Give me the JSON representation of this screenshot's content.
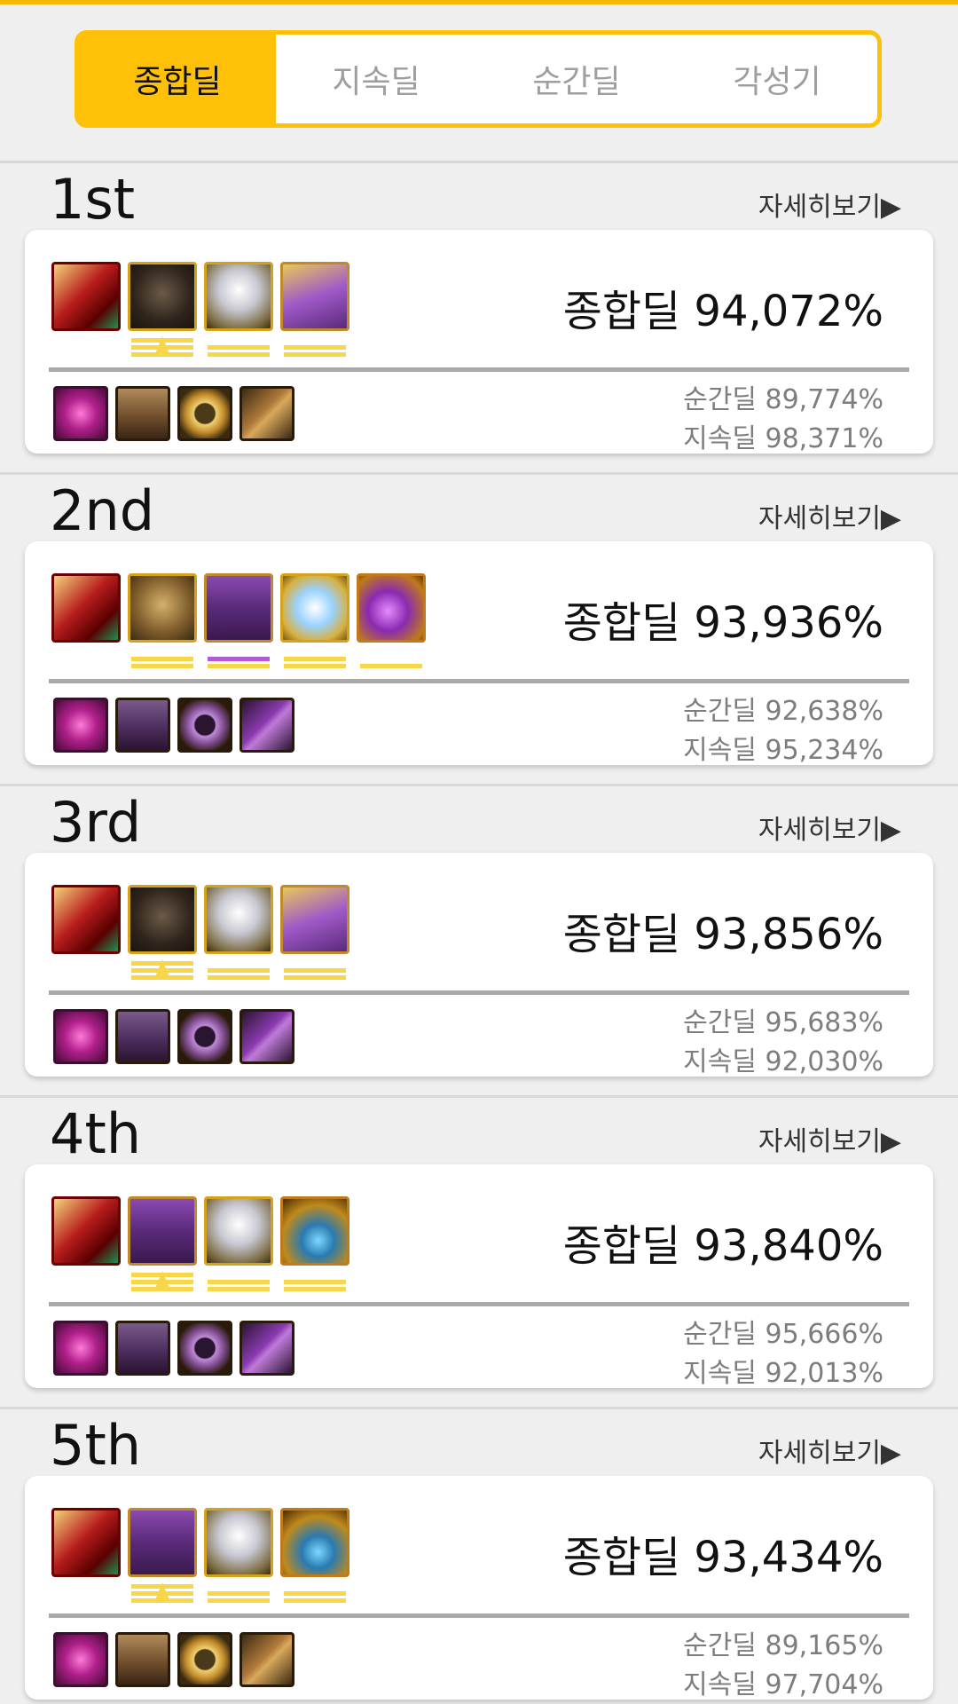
{
  "tabs": [
    {
      "label": "종합딜",
      "active": true
    },
    {
      "label": "지속딜",
      "active": false
    },
    {
      "label": "순간딜",
      "active": false
    },
    {
      "label": "각성기",
      "active": false
    }
  ],
  "detail_label": "자세히보기▶",
  "entries": [
    {
      "rank": "1st",
      "total": "종합딜 94,072%",
      "burst": "순간딜 89,774%",
      "sustain": "지속딜 98,371%",
      "top_icons": [
        "weapon-icon",
        "armor-icon",
        "helmet-icon",
        "crystal-icon"
      ],
      "bottom_icons": [
        "rose-icon",
        "pants-icon",
        "ring-icon",
        "spike-icon"
      ]
    },
    {
      "rank": "2nd",
      "total": "종합딜 93,936%",
      "burst": "순간딜 92,638%",
      "sustain": "지속딜 95,234%",
      "top_icons": [
        "weapon-icon",
        "armor-icon",
        "robe-icon",
        "orb-icon",
        "gem-icon"
      ],
      "bottom_icons": [
        "rose-icon",
        "pants-icon",
        "ring-icon",
        "spike-icon"
      ]
    },
    {
      "rank": "3rd",
      "total": "종합딜 93,856%",
      "burst": "순간딜 95,683%",
      "sustain": "지속딜 92,030%",
      "top_icons": [
        "weapon-icon",
        "armor-icon",
        "helmet-icon",
        "crystal-icon"
      ],
      "bottom_icons": [
        "rose-icon",
        "pants-icon",
        "ring-icon",
        "spike-icon"
      ]
    },
    {
      "rank": "4th",
      "total": "종합딜 93,840%",
      "burst": "순간딜 95,666%",
      "sustain": "지속딜 92,013%",
      "top_icons": [
        "weapon-icon",
        "robe-icon",
        "helmet-icon",
        "pendant-icon"
      ],
      "bottom_icons": [
        "rose-icon",
        "pants-icon",
        "ring-icon",
        "spike-icon"
      ]
    },
    {
      "rank": "5th",
      "total": "종합딜 93,434%",
      "burst": "순간딜 89,165%",
      "sustain": "지속딜 97,704%",
      "top_icons": [
        "weapon-icon",
        "robe-icon",
        "helmet-icon",
        "pendant-icon"
      ],
      "bottom_icons": [
        "rose-icon",
        "pants-icon",
        "ring-icon",
        "spike-icon"
      ]
    }
  ]
}
